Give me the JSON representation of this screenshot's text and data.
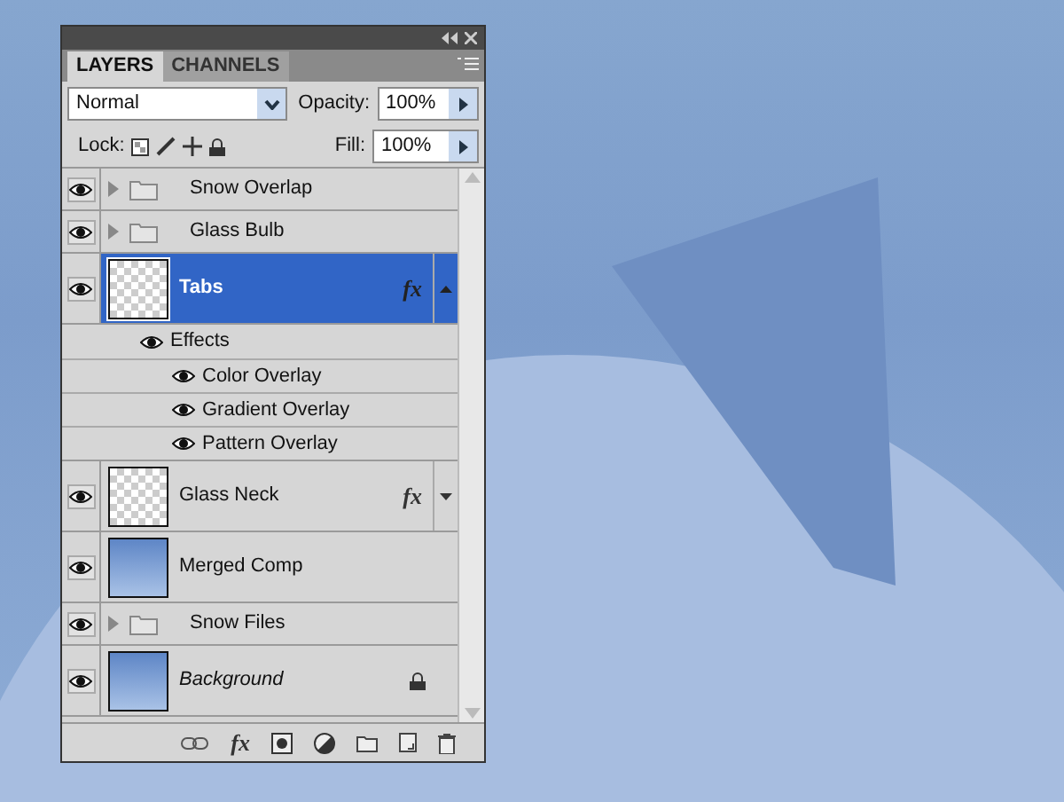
{
  "panel": {
    "tabs": [
      {
        "label": "LAYERS",
        "selected": true
      },
      {
        "label": "CHANNELS",
        "selected": false
      }
    ],
    "blend_mode": "Normal",
    "opacity_label": "Opacity:",
    "opacity": "100%",
    "lock_label": "Lock:",
    "fill_label": "Fill:",
    "fill": "100%",
    "layers": [
      {
        "kind": "group",
        "name": "Snow Overlap",
        "visible": true,
        "selected": false,
        "expanded": false
      },
      {
        "kind": "group",
        "name": "Glass Bulb",
        "visible": true,
        "selected": false,
        "expanded": false
      },
      {
        "kind": "layer",
        "transparent": true,
        "name": "Tabs",
        "visible": true,
        "selected": true,
        "fx": "fx",
        "expanded": true,
        "effects_label": "Effects",
        "effects": [
          {
            "name": "Color Overlay",
            "visible": true
          },
          {
            "name": "Gradient Overlay",
            "visible": true
          },
          {
            "name": "Pattern Overlay",
            "visible": true
          }
        ]
      },
      {
        "kind": "layer",
        "transparent": true,
        "name": "Glass Neck",
        "visible": true,
        "selected": false,
        "fx": "fx",
        "expanded": false
      },
      {
        "kind": "layer",
        "transparent": false,
        "name": "Merged Comp",
        "visible": true,
        "selected": false
      },
      {
        "kind": "group",
        "name": "Snow Files",
        "visible": true,
        "selected": false,
        "expanded": false
      },
      {
        "kind": "background",
        "transparent": false,
        "name": "Background",
        "visible": true,
        "selected": false,
        "locked": true
      }
    ],
    "footer_fx": "fx"
  }
}
